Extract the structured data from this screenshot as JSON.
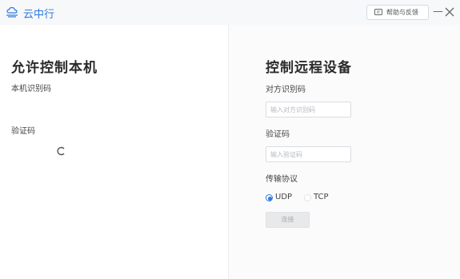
{
  "app": {
    "title": "云中行",
    "logo_icon": "cloud-logo-icon",
    "accent": "#2f7bd9"
  },
  "titlebar": {
    "help_label": "帮助与反馈",
    "help_icon": "feedback-icon",
    "minimize_label": "—",
    "close_icon": "close-icon"
  },
  "left": {
    "heading": "允许控制本机",
    "machine_id_label": "本机识别码",
    "code_label": "验证码",
    "loading_icon": "loading-spinner-icon"
  },
  "right": {
    "heading": "控制远程设备",
    "peer_id_label": "对方识别码",
    "peer_id_placeholder": "输入对方识别码",
    "peer_id_value": "",
    "code_label": "验证码",
    "code_placeholder": "输入验证码",
    "code_value": "",
    "protocol_label": "传输协议",
    "protocols": [
      {
        "label": "UDP",
        "selected": true
      },
      {
        "label": "TCP",
        "selected": false
      }
    ],
    "connect_label": "连接"
  }
}
